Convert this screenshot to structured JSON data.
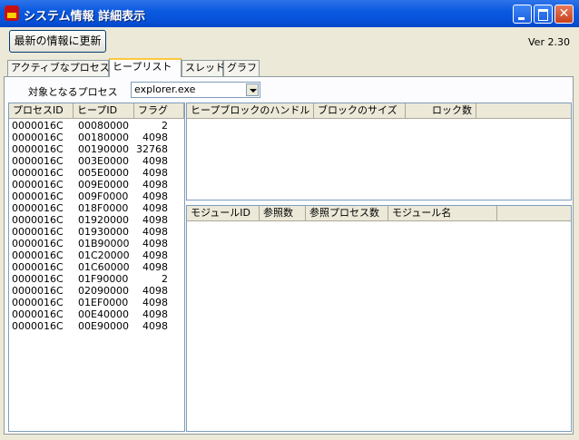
{
  "window": {
    "title": "システム情報 詳細表示"
  },
  "toolbar": {
    "refresh_label": "最新の情報に更新",
    "version": "Ver 2.30"
  },
  "tabs": [
    {
      "label": "アクティブなプロセス"
    },
    {
      "label": "ヒープリスト"
    },
    {
      "label": "スレッド"
    },
    {
      "label": "グラフ"
    }
  ],
  "process": {
    "label": "対象となるプロセス",
    "selected": "explorer.exe"
  },
  "heap_list": {
    "columns": [
      "プロセスID",
      "ヒープID",
      "フラグ"
    ],
    "rows": [
      [
        "0000016C",
        "00080000",
        "2"
      ],
      [
        "0000016C",
        "00180000",
        "4098"
      ],
      [
        "0000016C",
        "00190000",
        "32768"
      ],
      [
        "0000016C",
        "003E0000",
        "4098"
      ],
      [
        "0000016C",
        "005E0000",
        "4098"
      ],
      [
        "0000016C",
        "009E0000",
        "4098"
      ],
      [
        "0000016C",
        "009F0000",
        "4098"
      ],
      [
        "0000016C",
        "018F0000",
        "4098"
      ],
      [
        "0000016C",
        "01920000",
        "4098"
      ],
      [
        "0000016C",
        "01930000",
        "4098"
      ],
      [
        "0000016C",
        "01B90000",
        "4098"
      ],
      [
        "0000016C",
        "01C20000",
        "4098"
      ],
      [
        "0000016C",
        "01C60000",
        "4098"
      ],
      [
        "0000016C",
        "01F90000",
        "2"
      ],
      [
        "0000016C",
        "02090000",
        "4098"
      ],
      [
        "0000016C",
        "01EF0000",
        "4098"
      ],
      [
        "0000016C",
        "00E40000",
        "4098"
      ],
      [
        "0000016C",
        "00E90000",
        "4098"
      ]
    ]
  },
  "heap_blocks": {
    "columns": [
      "ヒープブロックのハンドル",
      "ブロックのサイズ",
      "ロック数"
    ]
  },
  "modules": {
    "columns": [
      "モジュールID",
      "参照数",
      "参照プロセス数",
      "モジュール名"
    ]
  }
}
